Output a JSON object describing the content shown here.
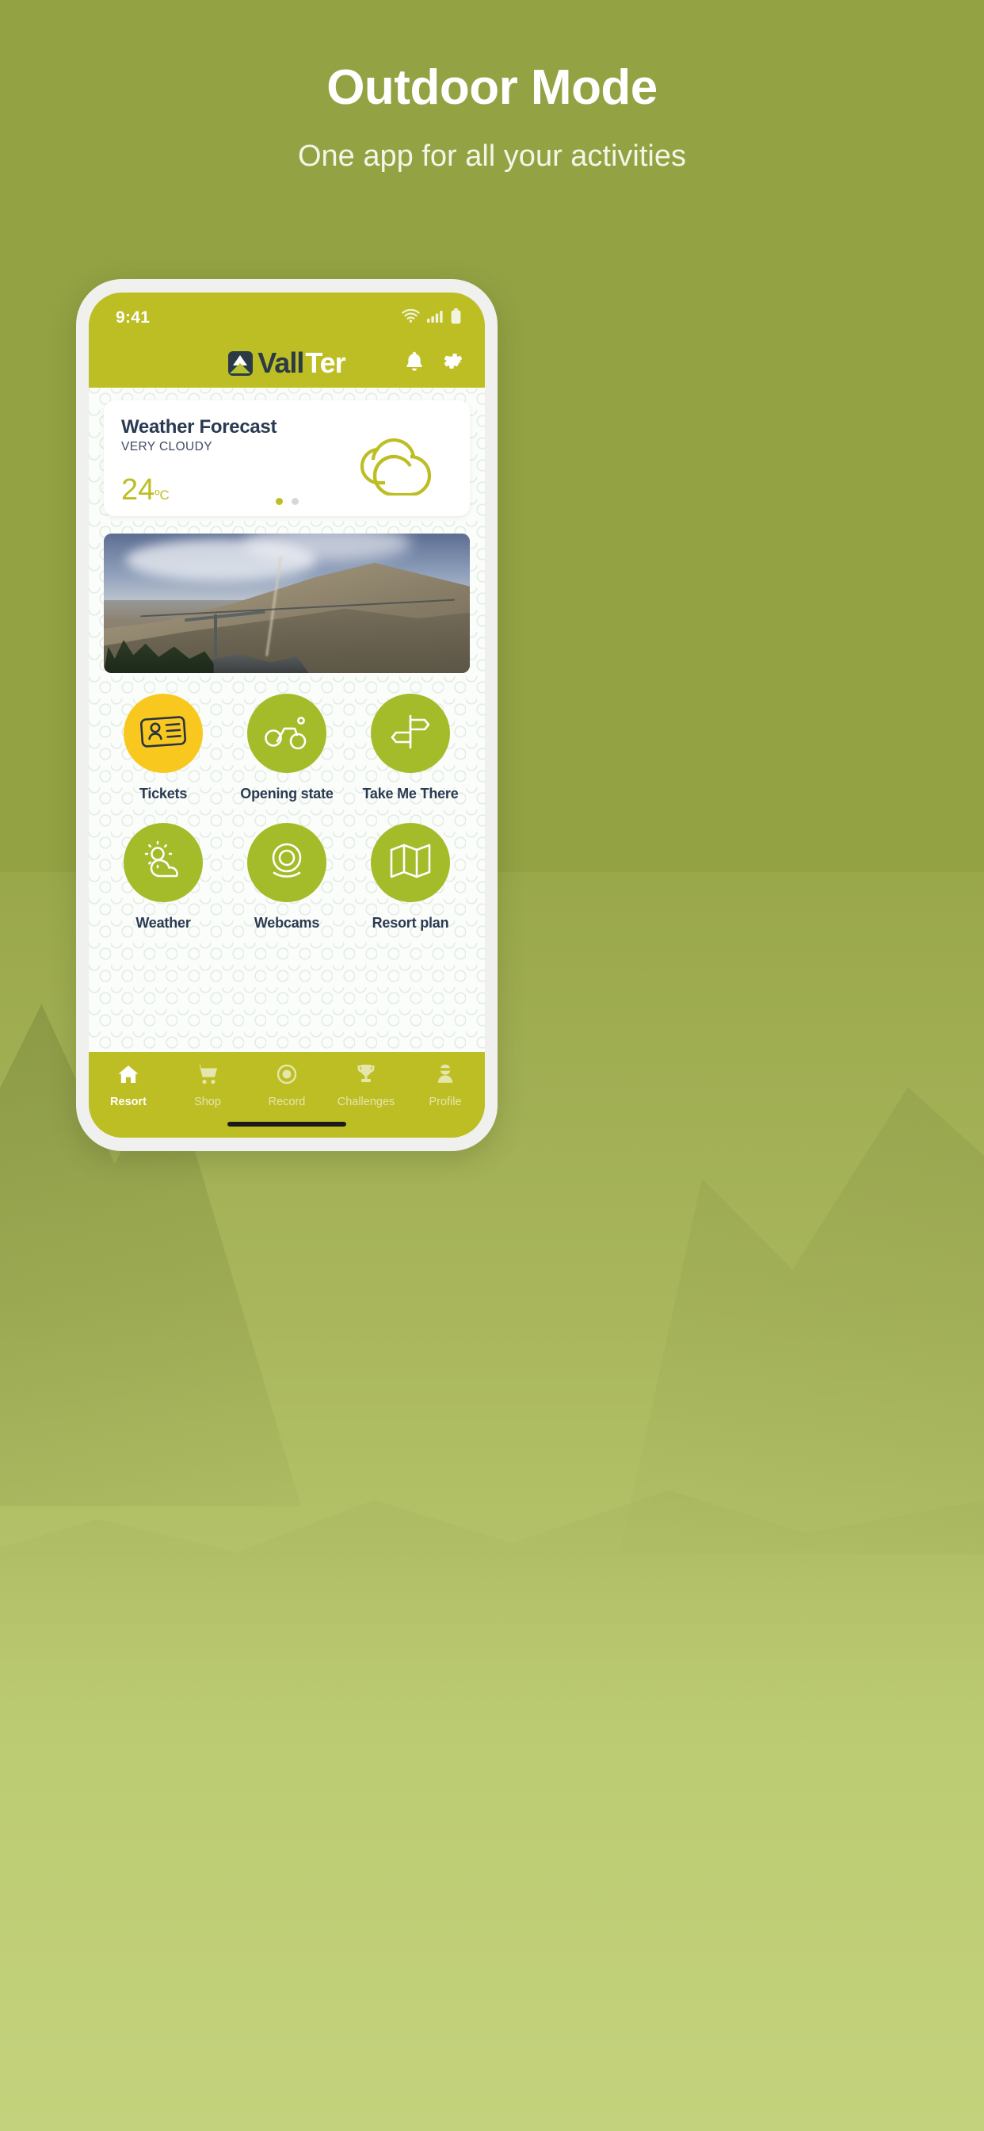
{
  "promo": {
    "title": "Outdoor Mode",
    "subtitle": "One app for all your activities",
    "bg_color": "#93a243"
  },
  "phone": {
    "status_bar": {
      "time": "9:41",
      "icons": [
        "wifi-icon",
        "cellular-signal-icon",
        "battery-icon"
      ]
    },
    "app_bar": {
      "brand_primary": "Vall",
      "brand_secondary": "Ter",
      "logo_icon": "mountain-logo-icon",
      "actions": [
        {
          "name": "notifications-button",
          "icon": "bell-icon"
        },
        {
          "name": "settings-button",
          "icon": "gear-icon"
        }
      ],
      "bg_color": "#bdbe24"
    },
    "weather_card": {
      "title": "Weather Forecast",
      "condition": "VERY CLOUDY",
      "temperature": "24",
      "unit": "ºC",
      "icon": "cloudy-icon",
      "accent_color": "#bdbe24",
      "pager": {
        "total": 2,
        "active": 1
      }
    },
    "hero_image": {
      "alt": "Mountain ski lift and ridge photo",
      "icon": "mountain-photo"
    },
    "tiles": [
      {
        "label": "Tickets",
        "icon": "ticket-card-icon",
        "color": "#f9c81f",
        "style": "amber"
      },
      {
        "label": "Opening state",
        "icon": "bicycle-icon",
        "color": "#a4bc2a",
        "style": "green"
      },
      {
        "label": "Take Me There",
        "icon": "signpost-icon",
        "color": "#a4bc2a",
        "style": "green"
      },
      {
        "label": "Weather",
        "icon": "sun-cloud-icon",
        "color": "#a4bc2a",
        "style": "green"
      },
      {
        "label": "Webcams",
        "icon": "webcam-icon",
        "color": "#a4bc2a",
        "style": "green"
      },
      {
        "label": "Resort plan",
        "icon": "map-folded-icon",
        "color": "#a4bc2a",
        "style": "green"
      }
    ],
    "tab_bar": {
      "bg_color": "#bdbe24",
      "items": [
        {
          "label": "Resort",
          "icon": "home-icon",
          "active": true
        },
        {
          "label": "Shop",
          "icon": "cart-icon",
          "active": false
        },
        {
          "label": "Record",
          "icon": "record-icon",
          "active": false
        },
        {
          "label": "Challenges",
          "icon": "trophy-icon",
          "active": false
        },
        {
          "label": "Profile",
          "icon": "person-icon",
          "active": false
        }
      ]
    }
  }
}
